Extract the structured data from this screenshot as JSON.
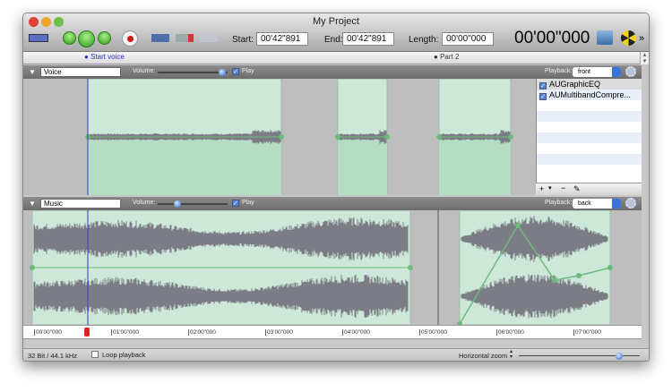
{
  "window": {
    "title": "My Project"
  },
  "toolbar": {
    "start_label": "Start:",
    "start_value": "00'42\"891",
    "end_label": "End:",
    "end_value": "00'42\"891",
    "length_label": "Length:",
    "length_value": "00'00\"000",
    "current_time": "00'00\"000",
    "more": "»"
  },
  "markers": [
    {
      "label": "Start voice"
    },
    {
      "label": "Part 2"
    }
  ],
  "tracks": [
    {
      "name": "Voice",
      "volume_label": "Volume:",
      "volume": 0.95,
      "play_label": "Play",
      "play": true,
      "playback_label": "Playback:",
      "playback": "front"
    },
    {
      "name": "Music",
      "volume_label": "Volume:",
      "volume": 0.25,
      "play_label": "Play",
      "play": true,
      "playback_label": "Playback:",
      "playback": "back"
    }
  ],
  "effects": [
    {
      "name": "AUGraphicEQ",
      "enabled": true
    },
    {
      "name": "AUMultibandCompre...",
      "enabled": true
    }
  ],
  "effects_toolbar": {
    "add": "+",
    "menu": "▾",
    "remove": "−"
  },
  "ruler": [
    "00'00\"000",
    "01'00\"000",
    "02'00\"000",
    "03'00\"000",
    "04'00\"000",
    "05'00\"000",
    "06'00\"000",
    "07'00\"000"
  ],
  "status": {
    "format": "32 Bit / 44.1 kHz",
    "loop_label": "Loop playback",
    "loop": false,
    "zoom_label": "Horizontal zoom",
    "zoom": 0.85
  },
  "colors": {
    "region": "#cde8d8",
    "envelope": "#6dbb7a",
    "wave": "#7c7c86",
    "playhead": "#3b3bd0"
  }
}
